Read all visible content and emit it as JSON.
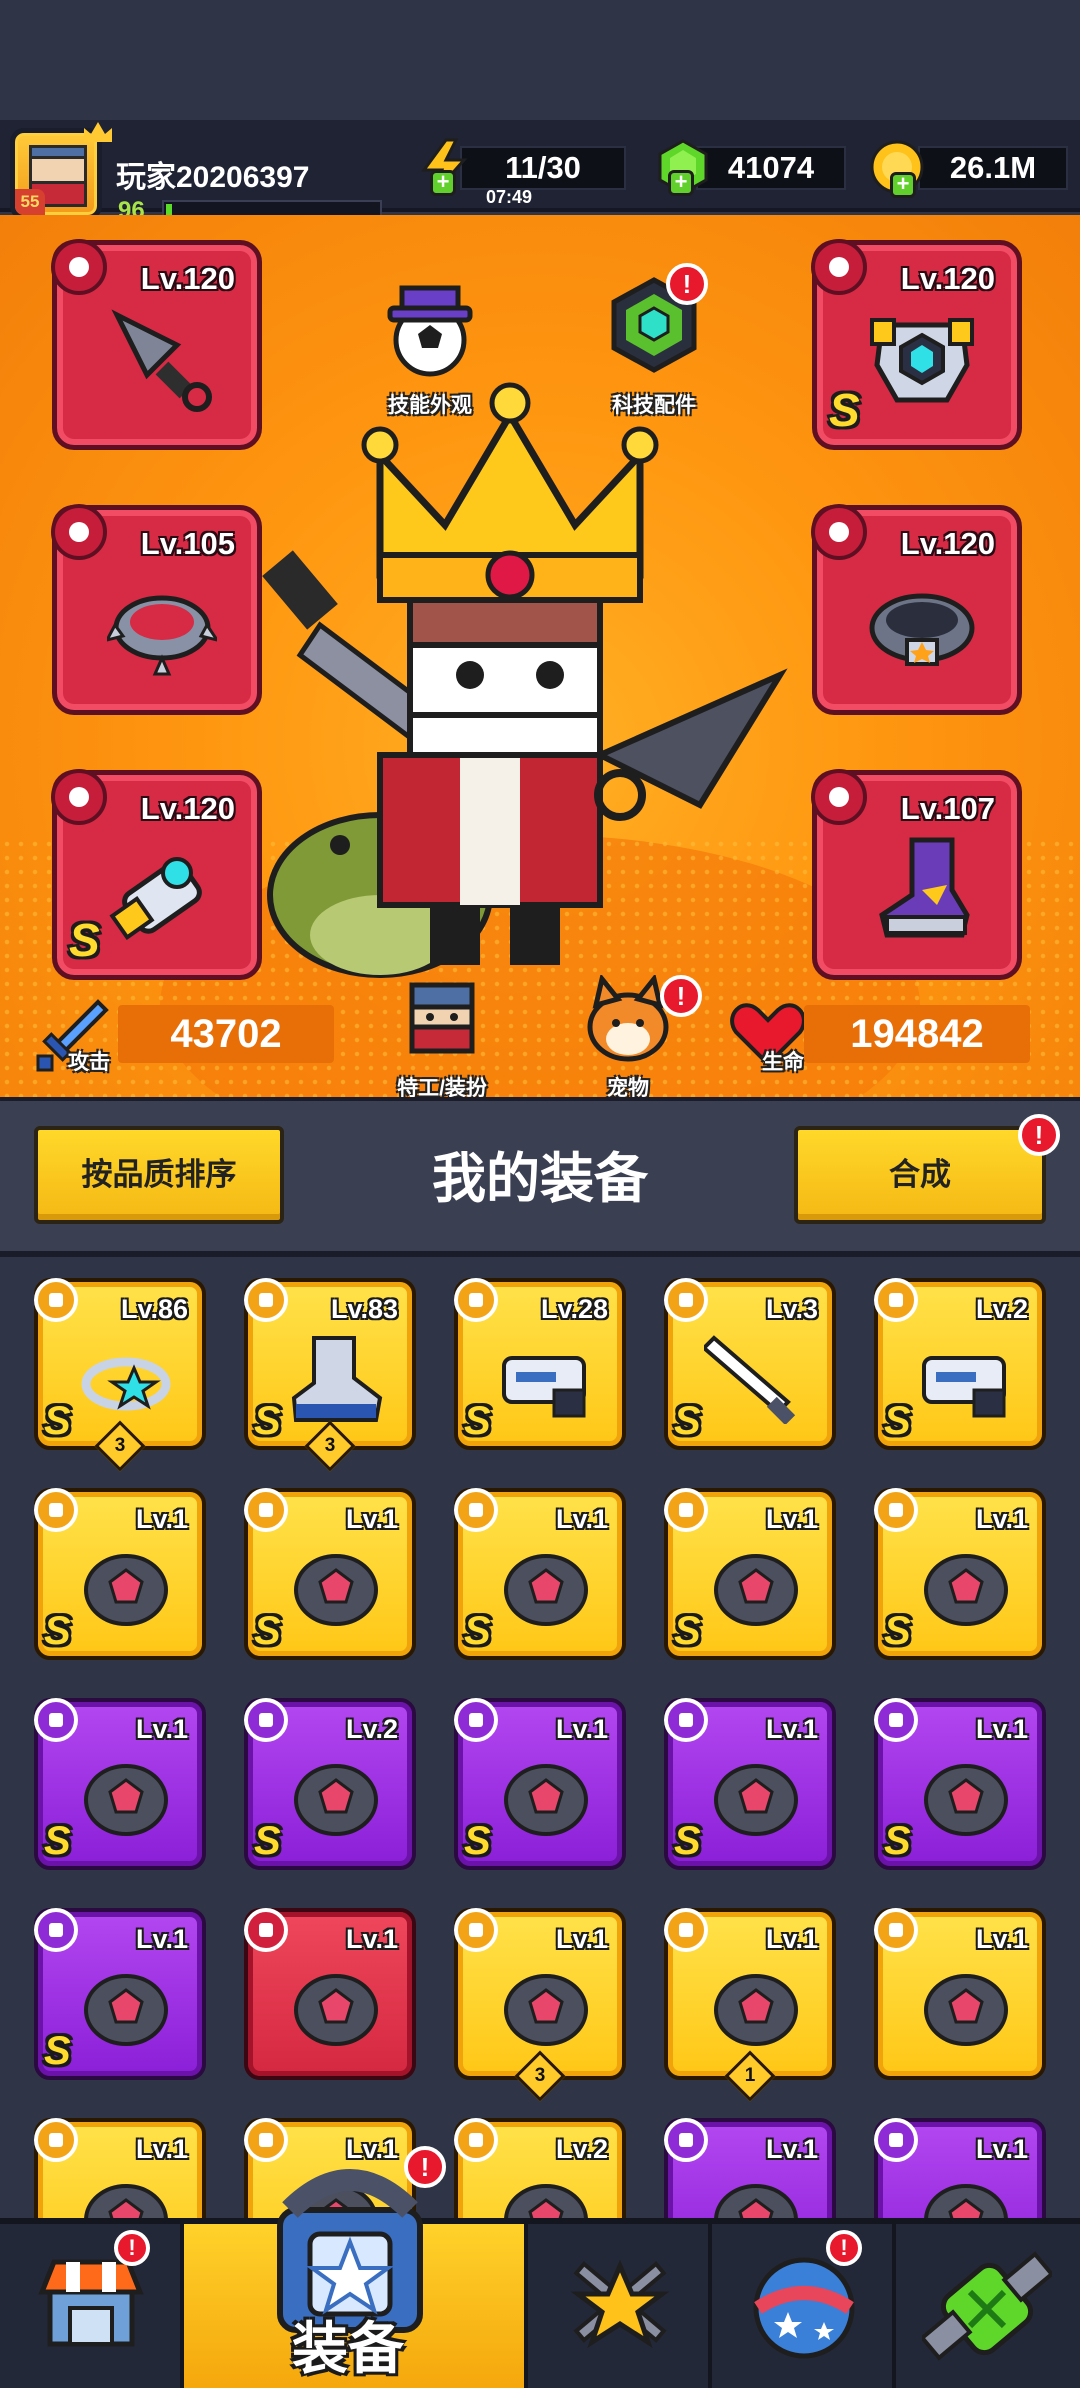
{
  "player": {
    "name": "玩家20206397",
    "level": "96",
    "badge_level": "55",
    "xp_fraction": 0.03
  },
  "resources": {
    "energy": {
      "value": "11/30",
      "timer": "07:49"
    },
    "gems": {
      "value": "41074"
    },
    "coins": {
      "value": "26.1M"
    }
  },
  "hero": {
    "slots": [
      {
        "level": "Lv.120",
        "rank": ""
      },
      {
        "level": "Lv.105",
        "rank": ""
      },
      {
        "level": "Lv.120",
        "rank": "S"
      },
      {
        "level": "Lv.120",
        "rank": "S"
      },
      {
        "level": "Lv.120",
        "rank": ""
      },
      {
        "level": "Lv.107",
        "rank": ""
      }
    ],
    "skill_look_label": "技能外观",
    "tech_parts_label": "科技配件",
    "agent_label": "特工/装扮",
    "pet_label": "宠物",
    "attack_label": "攻击",
    "attack_value": "43702",
    "hp_label": "生命",
    "hp_value": "194842",
    "badge_mark": "!"
  },
  "toolbar": {
    "sort_label": "按品质排序",
    "title": "我的装备",
    "merge_label": "合成"
  },
  "inventory": [
    {
      "level": "Lv.86",
      "rank": "S",
      "stars": "3",
      "quality": "gold"
    },
    {
      "level": "Lv.83",
      "rank": "S",
      "stars": "3",
      "quality": "gold"
    },
    {
      "level": "Lv.28",
      "rank": "S",
      "stars": "",
      "quality": "gold"
    },
    {
      "level": "Lv.3",
      "rank": "S",
      "stars": "",
      "quality": "gold"
    },
    {
      "level": "Lv.2",
      "rank": "S",
      "stars": "",
      "quality": "gold"
    },
    {
      "level": "Lv.1",
      "rank": "S",
      "stars": "",
      "quality": "gold"
    },
    {
      "level": "Lv.1",
      "rank": "S",
      "stars": "",
      "quality": "gold"
    },
    {
      "level": "Lv.1",
      "rank": "S",
      "stars": "",
      "quality": "gold"
    },
    {
      "level": "Lv.1",
      "rank": "S",
      "stars": "",
      "quality": "gold"
    },
    {
      "level": "Lv.1",
      "rank": "S",
      "stars": "",
      "quality": "gold"
    },
    {
      "level": "Lv.1",
      "rank": "S",
      "stars": "",
      "quality": "purple"
    },
    {
      "level": "Lv.2",
      "rank": "S",
      "stars": "",
      "quality": "purple"
    },
    {
      "level": "Lv.1",
      "rank": "S",
      "stars": "",
      "quality": "purple"
    },
    {
      "level": "Lv.1",
      "rank": "S",
      "stars": "",
      "quality": "purple"
    },
    {
      "level": "Lv.1",
      "rank": "S",
      "stars": "",
      "quality": "purple"
    },
    {
      "level": "Lv.1",
      "rank": "S",
      "stars": "",
      "quality": "purple"
    },
    {
      "level": "Lv.1",
      "rank": "",
      "stars": "",
      "quality": "red"
    },
    {
      "level": "Lv.1",
      "rank": "",
      "stars": "3",
      "quality": "gold"
    },
    {
      "level": "Lv.1",
      "rank": "",
      "stars": "1",
      "quality": "gold"
    },
    {
      "level": "Lv.1",
      "rank": "",
      "stars": "",
      "quality": "gold"
    },
    {
      "level": "Lv.1",
      "rank": "",
      "stars": "",
      "quality": "gold"
    },
    {
      "level": "Lv.1",
      "rank": "",
      "stars": "",
      "quality": "gold"
    },
    {
      "level": "Lv.2",
      "rank": "",
      "stars": "",
      "quality": "gold"
    },
    {
      "level": "Lv.1",
      "rank": "",
      "stars": "",
      "quality": "purple"
    },
    {
      "level": "Lv.1",
      "rank": "",
      "stars": "",
      "quality": "purple"
    }
  ],
  "nav": {
    "tabs": [
      {
        "icon": "shop-icon",
        "label": ""
      },
      {
        "icon": "equipment-icon",
        "label": "装备"
      },
      {
        "icon": "battle-star-icon",
        "label": ""
      },
      {
        "icon": "planet-icon",
        "label": ""
      },
      {
        "icon": "dna-capsule-icon",
        "label": ""
      }
    ]
  }
}
